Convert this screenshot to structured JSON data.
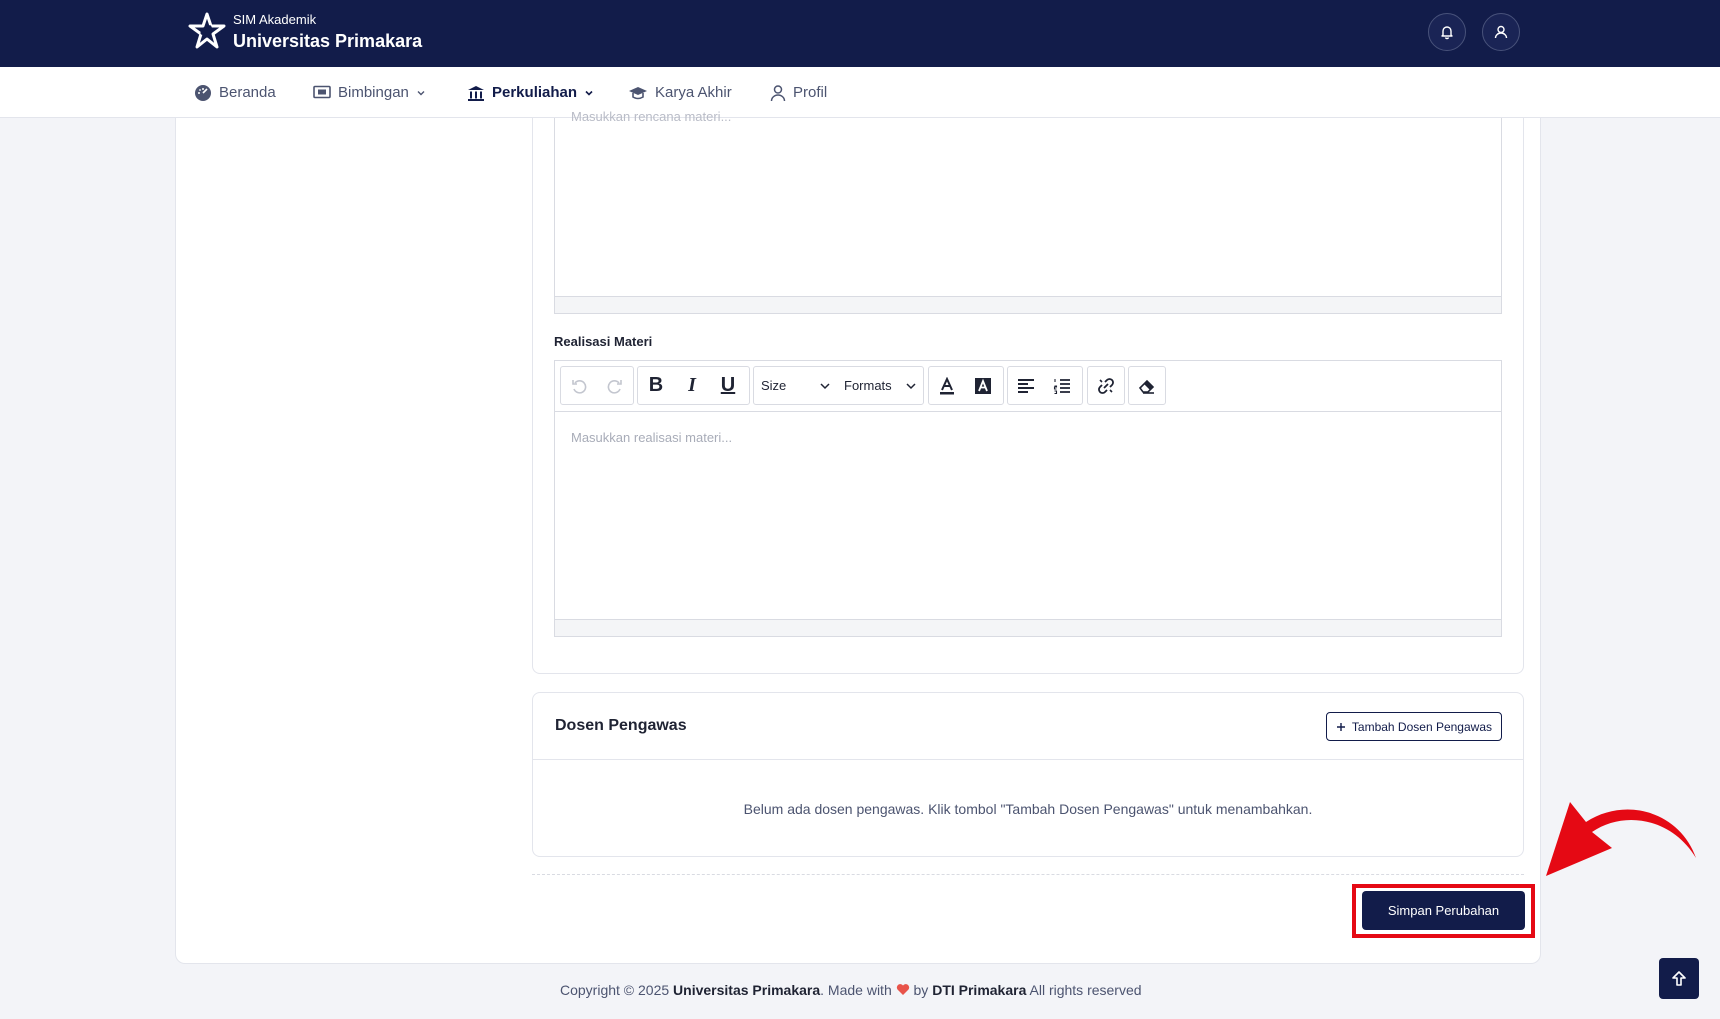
{
  "header": {
    "brand_small": "SIM Akademik",
    "brand_title": "Universitas Primakara",
    "icons": [
      "bell-icon",
      "user-icon"
    ]
  },
  "nav": {
    "items": [
      {
        "label": "Beranda",
        "icon": "dashboard-icon"
      },
      {
        "label": "Bimbingan",
        "icon": "presentation-icon",
        "dropdown": true
      },
      {
        "label": "Perkuliahan",
        "icon": "institution-icon",
        "dropdown": true,
        "active": true
      },
      {
        "label": "Karya Akhir",
        "icon": "graduation-cap-icon"
      },
      {
        "label": "Profil",
        "icon": "user-icon"
      }
    ]
  },
  "form": {
    "top_editor_placeholder": "Masukkan rencana materi...",
    "realisasi_label": "Realisasi Materi",
    "realisasi_placeholder": "Masukkan realisasi materi...",
    "toolbar": {
      "size_label": "Size",
      "formats_label": "Formats",
      "bold": "B",
      "italic": "I",
      "underline": "U"
    }
  },
  "dosen": {
    "title": "Dosen Pengawas",
    "add_label": "Tambah Dosen Pengawas",
    "empty_message": "Belum ada dosen pengawas. Klik tombol \"Tambah Dosen Pengawas\" untuk menambahkan."
  },
  "actions": {
    "save_label": "Simpan Perubahan"
  },
  "footer": {
    "prefix": "Copyright © 2025 ",
    "org": "Universitas Primakara",
    "made_with": ". Made with ",
    "by": " by ",
    "team": "DTI Primakara",
    "suffix": " All rights reserved"
  },
  "colors": {
    "primary": "#121c4a",
    "highlight": "#e50914",
    "heart": "#e8534a"
  }
}
